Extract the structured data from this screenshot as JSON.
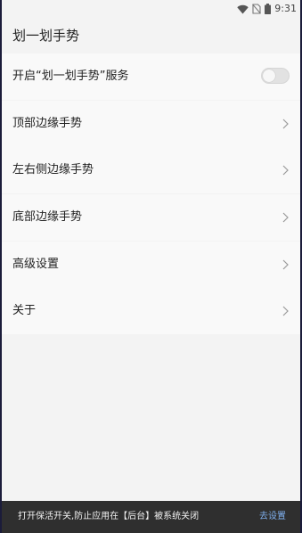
{
  "status_bar": {
    "time": "9:31",
    "icons": [
      "wifi-icon",
      "no-sim-icon",
      "battery-icon"
    ]
  },
  "app_bar": {
    "title": "划一划手势"
  },
  "settings": {
    "service_toggle": {
      "label": "开启“划一划手势”服务",
      "enabled": false
    },
    "items": [
      {
        "label": "顶部边缘手势",
        "icon": "chevron-right-icon"
      },
      {
        "label": "左右侧边缘手势",
        "icon": "chevron-right-icon"
      },
      {
        "label": "底部边缘手势",
        "icon": "chevron-right-icon"
      },
      {
        "label": "高级设置",
        "icon": "chevron-right-icon"
      },
      {
        "label": "关于",
        "icon": "chevron-right-icon"
      }
    ]
  },
  "snackbar": {
    "message": "打开保活开关,防止应用在【后台】被系统关闭",
    "action": "去设置"
  },
  "colors": {
    "background": "#f3f3f3",
    "list_background": "#f9f9f9",
    "snackbar_background": "#2f2f2f",
    "snackbar_action": "#7fb0ef"
  }
}
